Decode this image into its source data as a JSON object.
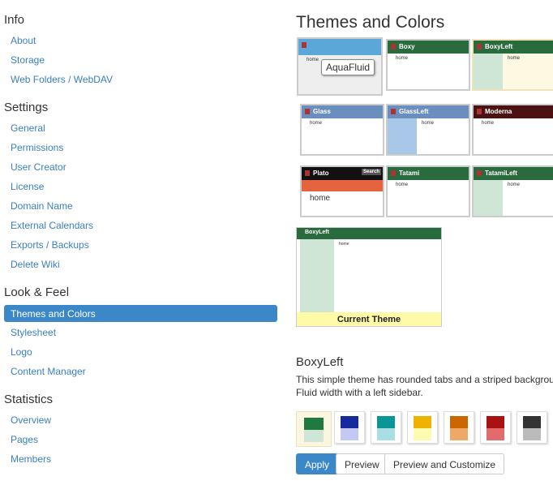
{
  "sidebar": {
    "sections": [
      {
        "title": "Info",
        "items": [
          "About",
          "Storage",
          "Web Folders / WebDAV"
        ]
      },
      {
        "title": "Settings",
        "items": [
          "General",
          "Permissions",
          "User Creator",
          "License",
          "Domain Name",
          "External Calendars",
          "Exports / Backups",
          "Delete Wiki"
        ]
      },
      {
        "title": "Look & Feel",
        "items": [
          "Themes and Colors",
          "Stylesheet",
          "Logo",
          "Content Manager"
        ],
        "selected": "Themes and Colors"
      },
      {
        "title": "Statistics",
        "items": [
          "Overview",
          "Pages",
          "Members"
        ]
      }
    ]
  },
  "main": {
    "title": "Themes and Colors",
    "themes": [
      {
        "name": "AquaFluid",
        "color": "#5aa7d8"
      },
      {
        "name": "Boxy",
        "color": "#2a6b3e"
      },
      {
        "name": "BoxyLeft",
        "color": "#2a6b3e"
      },
      {
        "name": "Glass",
        "color": "#6a8fbf"
      },
      {
        "name": "GlassLeft",
        "color": "#6a8fbf"
      },
      {
        "name": "Moderna",
        "color": "#4a1212"
      },
      {
        "name": "Plato",
        "color": "#111111"
      },
      {
        "name": "Tatami",
        "color": "#2a6b3e"
      },
      {
        "name": "TatamiLeft",
        "color": "#2a6b3e"
      }
    ],
    "tooltip": "AquaFluid",
    "home": "home",
    "plato_search": "Search",
    "current": {
      "name": "BoxyLeft",
      "label": "Current Theme"
    },
    "theme_name": "BoxyLeft",
    "description": "This simple theme has rounded tabs and a striped background. Fluid width with a left sidebar.",
    "swatches": [
      [
        "#1f7a3f",
        "#cfe6d6"
      ],
      [
        "#152a9c",
        "#c3c9f2"
      ],
      [
        "#0a9597",
        "#a9dfe2"
      ],
      [
        "#efb200",
        "#fdfbb0"
      ],
      [
        "#cc6600",
        "#f0a868"
      ],
      [
        "#aa1111",
        "#e46b6b"
      ],
      [
        "#333333",
        "#bbbbbb"
      ]
    ],
    "buttons": {
      "apply": "Apply",
      "preview": "Preview",
      "customize": "Preview and Customize"
    }
  }
}
